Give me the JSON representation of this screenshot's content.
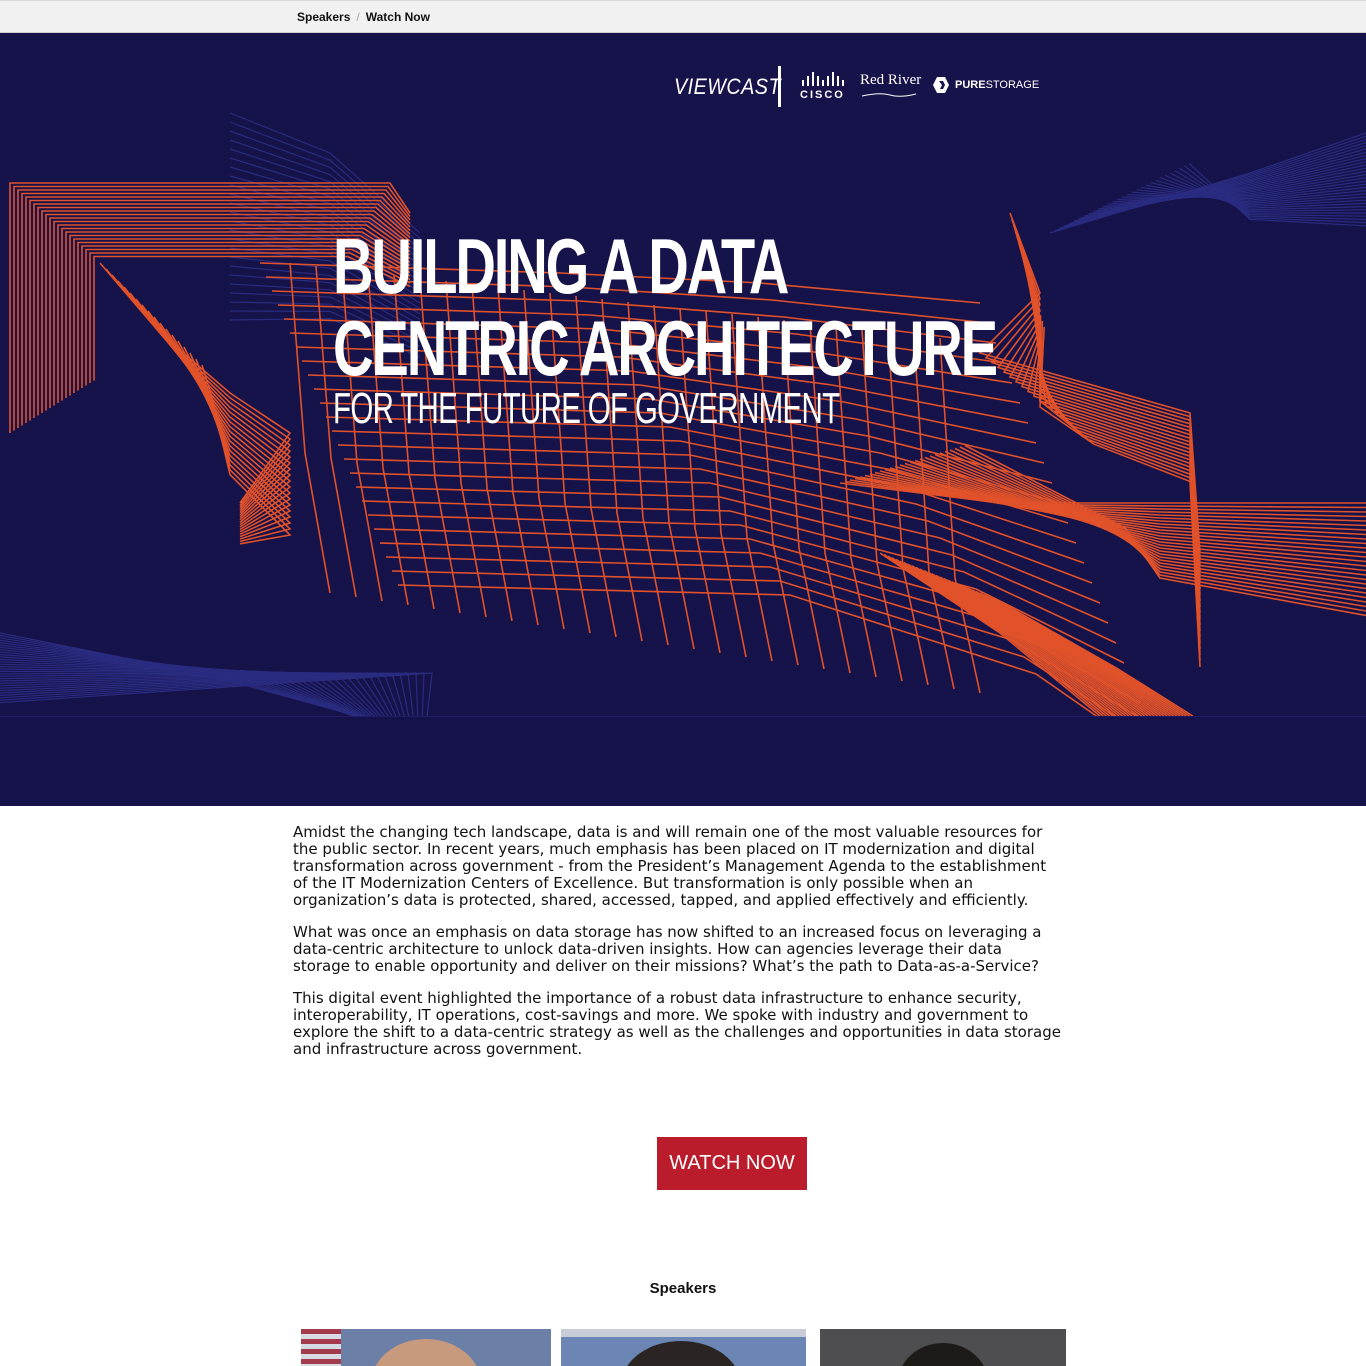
{
  "breadcrumb": {
    "items": [
      "Speakers",
      "Watch Now"
    ],
    "separator": "/"
  },
  "hero": {
    "title_line1": "BUILDING A DATA",
    "title_line2": "CENTRIC ARCHITECTURE",
    "subtitle": "FOR THE FUTURE OF GOVERNMENT",
    "background_color": "#16124a",
    "accent_color": "#e1522a"
  },
  "sponsors": {
    "viewcast": "VIEWCAST",
    "cisco": "CISCO",
    "redriver": "Red River",
    "pure_bold": "PURE",
    "pure_light": "STORAGE"
  },
  "intro": {
    "paragraphs": [
      "Amidst the changing tech landscape, data is and will remain one of the most valuable resources for the public sector. In recent years, much emphasis has been placed on IT modernization and digital transformation across government - from the President’s Management Agenda to the establishment of the IT Modernization Centers of Excellence. But transformation is only possible when an organization’s data is protected, shared, accessed, tapped, and applied effectively and efficiently.",
      "What was once an emphasis on data storage has now shifted to an increased focus on leveraging a data-centric architecture to unlock data-driven insights. How can agencies leverage their data storage to enable opportunity and deliver on their missions? What’s the path to Data-as-a-Service?",
      "This digital event highlighted the importance of a robust data infrastructure to enhance security, interoperability, IT operations, cost-savings and more. We spoke with industry and government to explore the shift to a data-centric strategy as well as the challenges and opportunities in data storage and infrastructure across government."
    ]
  },
  "cta": {
    "label": "WATCH NOW",
    "color": "#ba1c2b"
  },
  "speakers": {
    "heading": "Speakers"
  }
}
